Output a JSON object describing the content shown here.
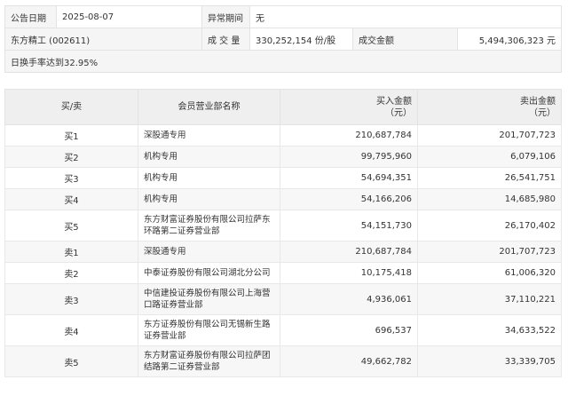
{
  "info": {
    "announce_date_label": "公告日期",
    "announce_date_value": "2025-08-07",
    "abnormal_period_label": "异常期间",
    "abnormal_period_value": "无",
    "stock_name": "东方精工 (002611)",
    "volume_label": "成 交 量",
    "volume_value": "330,252,154 份/股",
    "amount_label": "成交金额",
    "amount_value": "5,494,306,323 元",
    "reason": "日换手率达到32.95%"
  },
  "table": {
    "headers": {
      "side": "买/卖",
      "dept": "会员营业部名称",
      "buy_line1": "买入金额",
      "buy_line2": "（元）",
      "sell_line1": "卖出金额",
      "sell_line2": "（元）"
    },
    "rows": [
      {
        "side": "买1",
        "dept": "深股通专用",
        "buy": "210,687,784",
        "sell": "201,707,723"
      },
      {
        "side": "买2",
        "dept": "机构专用",
        "buy": "99,795,960",
        "sell": "6,079,106"
      },
      {
        "side": "买3",
        "dept": "机构专用",
        "buy": "54,694,351",
        "sell": "26,541,751"
      },
      {
        "side": "买4",
        "dept": "机构专用",
        "buy": "54,166,206",
        "sell": "14,685,980"
      },
      {
        "side": "买5",
        "dept": "东方财富证券股份有限公司拉萨东环路第二证券营业部",
        "buy": "54,151,730",
        "sell": "26,170,402"
      },
      {
        "side": "卖1",
        "dept": "深股通专用",
        "buy": "210,687,784",
        "sell": "201,707,723"
      },
      {
        "side": "卖2",
        "dept": "中泰证券股份有限公司湖北分公司",
        "buy": "10,175,418",
        "sell": "61,006,320"
      },
      {
        "side": "卖3",
        "dept": "中信建投证券股份有限公司上海营口路证券营业部",
        "buy": "4,936,061",
        "sell": "37,110,221"
      },
      {
        "side": "卖4",
        "dept": "东方证券股份有限公司无锡新生路证券营业部",
        "buy": "696,537",
        "sell": "34,633,522"
      },
      {
        "side": "卖5",
        "dept": "东方财富证券股份有限公司拉萨团结路第二证券营业部",
        "buy": "49,662,782",
        "sell": "33,339,705"
      }
    ]
  }
}
